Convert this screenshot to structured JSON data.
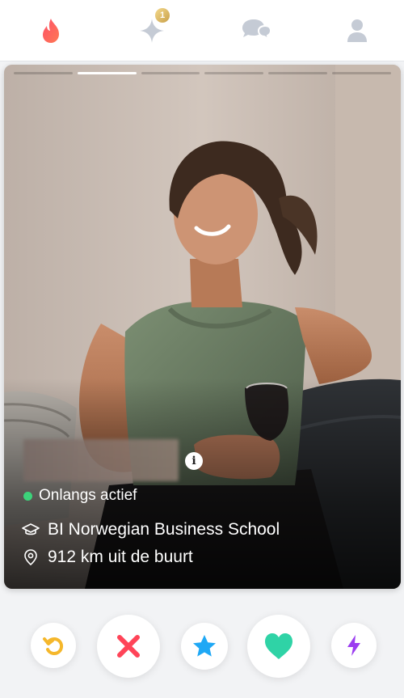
{
  "nav": {
    "items": [
      {
        "name": "flame-icon",
        "active": true
      },
      {
        "name": "gold-sparkle-icon",
        "badge": "1"
      },
      {
        "name": "chat-icon"
      },
      {
        "name": "profile-icon"
      }
    ]
  },
  "card": {
    "photo_count": 6,
    "active_photo": 2,
    "status": "Onlangs actief",
    "school": "BI Norwegian Business School",
    "distance": "912 km uit de buurt",
    "info_icon": "i"
  },
  "actions": [
    {
      "name": "rewind-button",
      "icon": "undo-icon",
      "color": "#f5b72b"
    },
    {
      "name": "nope-button",
      "icon": "x-icon",
      "color": "#ff4458"
    },
    {
      "name": "super-like-button",
      "icon": "star-icon",
      "color": "#1fa8f5"
    },
    {
      "name": "like-button",
      "icon": "heart-icon",
      "color": "#2fd3a6"
    },
    {
      "name": "boost-button",
      "icon": "bolt-icon",
      "color": "#9b3cf0"
    }
  ],
  "colors": {
    "brand": "#fd4f6b",
    "online": "#3cd37a"
  }
}
